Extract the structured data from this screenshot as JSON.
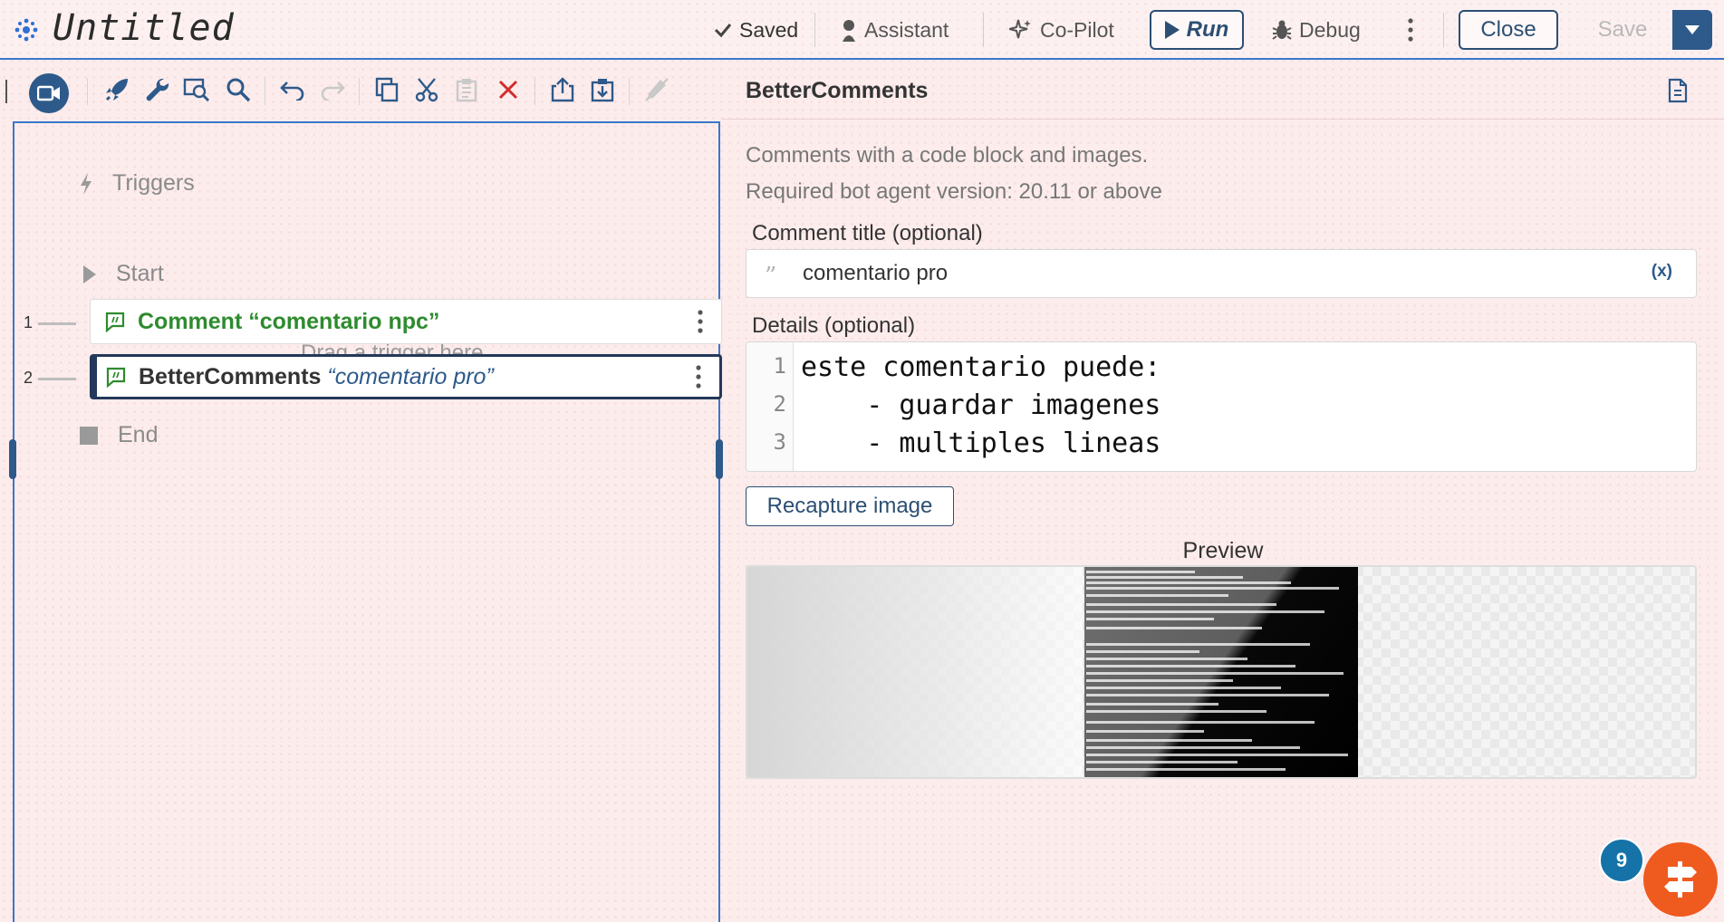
{
  "header": {
    "title": "Untitled",
    "saved_label": "Saved",
    "assistant_label": "Assistant",
    "copilot_label": "Co-Pilot",
    "run_label": "Run",
    "debug_label": "Debug",
    "close_label": "Close",
    "save_label": "Save"
  },
  "flow": {
    "triggers_label": "Triggers",
    "drag_hint": "Drag a trigger here...",
    "start_label": "Start",
    "end_label": "End",
    "steps": [
      {
        "number": "1",
        "name": "Comment",
        "detail": "“comentario npc”"
      },
      {
        "number": "2",
        "name": "BetterComments",
        "detail": "“comentario pro”"
      }
    ]
  },
  "details": {
    "title": "BetterComments",
    "description": "Comments with a code block and images.",
    "version_note": "Required bot agent version: 20.11 or above",
    "comment_title_label": "Comment title (optional)",
    "comment_title_value": "comentario pro",
    "var_button": "(x)",
    "details_label": "Details (optional)",
    "code_lines": [
      {
        "n": "1",
        "text": "este comentario puede:"
      },
      {
        "n": "2",
        "text": "    - guardar imagenes"
      },
      {
        "n": "3",
        "text": "    - multiples lineas"
      }
    ],
    "recapture_label": "Recapture image",
    "preview_label": "Preview"
  },
  "help": {
    "badge_count": "9"
  },
  "colors": {
    "accent": "#2d5a8a",
    "comment_green": "#2e8b2e",
    "help_orange": "#ef5a1f",
    "badge_blue": "#1673a8",
    "delete_red": "#d42b2b"
  }
}
